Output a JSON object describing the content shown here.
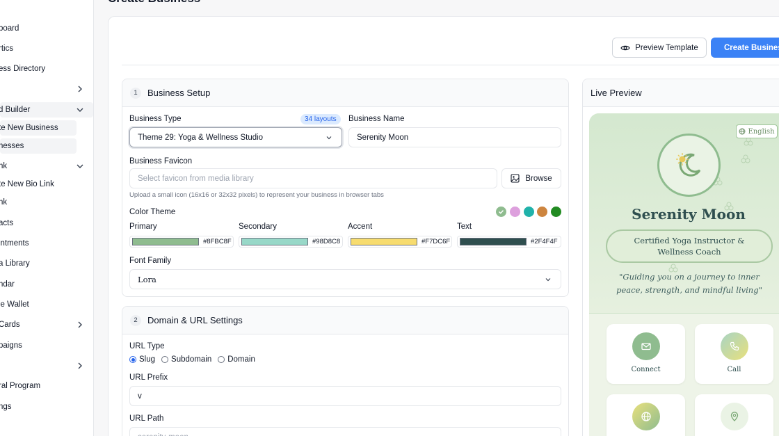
{
  "sidebar": {
    "items": [
      {
        "label": "board"
      },
      {
        "label": "rtics"
      },
      {
        "label": "ess Directory"
      },
      {
        "label": ""
      },
      {
        "label": "d Builder"
      },
      {
        "label": "te New Business"
      },
      {
        "label": "nesses"
      },
      {
        "label": "nk"
      },
      {
        "label": "te New Bio Link"
      },
      {
        "label": "nk"
      },
      {
        "label": "acts"
      },
      {
        "label": "intments"
      },
      {
        "label": "a Library"
      },
      {
        "label": "ndar"
      },
      {
        "label": "le Wallet"
      },
      {
        "label": "Cards"
      },
      {
        "label": "paigns"
      },
      {
        "label": ""
      },
      {
        "label": "ral Program"
      },
      {
        "label": "ngs"
      }
    ]
  },
  "page": {
    "title": "Create Business"
  },
  "toolbar": {
    "preview_label": "Preview Template",
    "create_label": "Create Business"
  },
  "business_setup": {
    "step": "1",
    "title": "Business Setup",
    "business_type_label": "Business Type",
    "layouts_badge": "34 layouts",
    "business_type_value": "Theme 29: Yoga & Wellness Studio",
    "business_name_label": "Business Name",
    "business_name_value": "Serenity Moon",
    "favicon_label": "Business Favicon",
    "favicon_placeholder": "Select favicon from media library",
    "browse_label": "Browse",
    "favicon_hint": "Upload a small icon (16x16 or 32x32 pixels) to represent your business in browser tabs",
    "color_theme_label": "Color Theme",
    "preset_colors": [
      "#8fbc8f",
      "#dda0dd",
      "#20b2aa",
      "#cd853f",
      "#228b22"
    ],
    "colors": [
      {
        "label": "Primary",
        "hex": "#8FBC8F"
      },
      {
        "label": "Secondary",
        "hex": "#98D8C8"
      },
      {
        "label": "Accent",
        "hex": "#F7DC6F"
      },
      {
        "label": "Text",
        "hex": "#2F4F4F"
      }
    ],
    "font_family_label": "Font Family",
    "font_family_value": "Lora"
  },
  "domain_settings": {
    "step": "2",
    "title": "Domain & URL Settings",
    "url_type_label": "URL Type",
    "url_type_options": [
      "Slug",
      "Subdomain",
      "Domain"
    ],
    "url_type_selected": "Slug",
    "url_prefix_label": "URL Prefix",
    "url_prefix_value": "v",
    "url_path_label": "URL Path",
    "url_path_value": "serenity-moon"
  },
  "live_preview": {
    "title": "Live Preview",
    "language": "English",
    "business_name": "Serenity Moon",
    "tagline": "Certified Yoga Instructor & Wellness Coach",
    "quote": "\"Guiding you on a journey to inner peace, strength, and mindful living\"",
    "actions": [
      {
        "label": "Connect",
        "icon": "mail-icon"
      },
      {
        "label": "Call",
        "icon": "phone-icon"
      },
      {
        "label": "",
        "icon": "globe-icon"
      },
      {
        "label": "",
        "icon": "map-pin-icon"
      }
    ]
  }
}
